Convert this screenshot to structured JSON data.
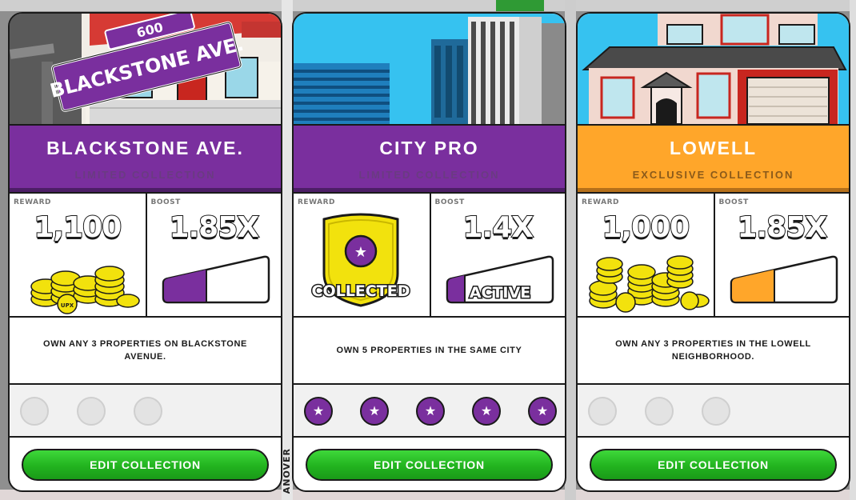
{
  "board": {
    "street_label": "ANOVER"
  },
  "cards": [
    {
      "title": "BLACKSTONE AVE.",
      "subtitle": "LIMITED COLLECTION",
      "banner_color": "#7a2f9e",
      "sign_text": "BLACKSTONE AVE.",
      "sign_number": "600",
      "reward_label": "REWARD",
      "reward_value": "1,100",
      "boost_label": "BOOST",
      "boost_value": "1.85X",
      "description": "OWN ANY 3 PROPERTIES ON BLACKSTONE AVENUE.",
      "progress_total": 3,
      "progress_filled": 0,
      "button_label": "EDIT COLLECTION"
    },
    {
      "title": "CITY PRO",
      "subtitle": "LIMITED COLLECTION",
      "banner_color": "#7a2f9e",
      "reward_label": "REWARD",
      "reward_badge": "COLLECTED",
      "boost_label": "BOOST",
      "boost_value": "1.4X",
      "boost_status": "ACTIVE",
      "description": "OWN 5 PROPERTIES IN THE SAME CITY",
      "progress_total": 5,
      "progress_filled": 5,
      "button_label": "EDIT COLLECTION"
    },
    {
      "title": "LOWELL",
      "subtitle": "EXCLUSIVE COLLECTION",
      "banner_color": "#ffa62a",
      "reward_label": "REWARD",
      "reward_value": "1,000",
      "boost_label": "BOOST",
      "boost_value": "1.85X",
      "description": "OWN ANY 3 PROPERTIES IN THE LOWELL NEIGHBORHOOD.",
      "progress_total": 3,
      "progress_filled": 0,
      "button_label": "EDIT COLLECTION"
    }
  ],
  "coin_label": "UPX",
  "colors": {
    "purple": "#7a2f9e",
    "orange": "#ffa62a",
    "green": "#22b31f",
    "coin": "#f2e20d"
  },
  "icons": {
    "reward": "upx-coin-stack-icon",
    "badge": "star-shield-icon",
    "boost": "boost-meter-icon"
  }
}
